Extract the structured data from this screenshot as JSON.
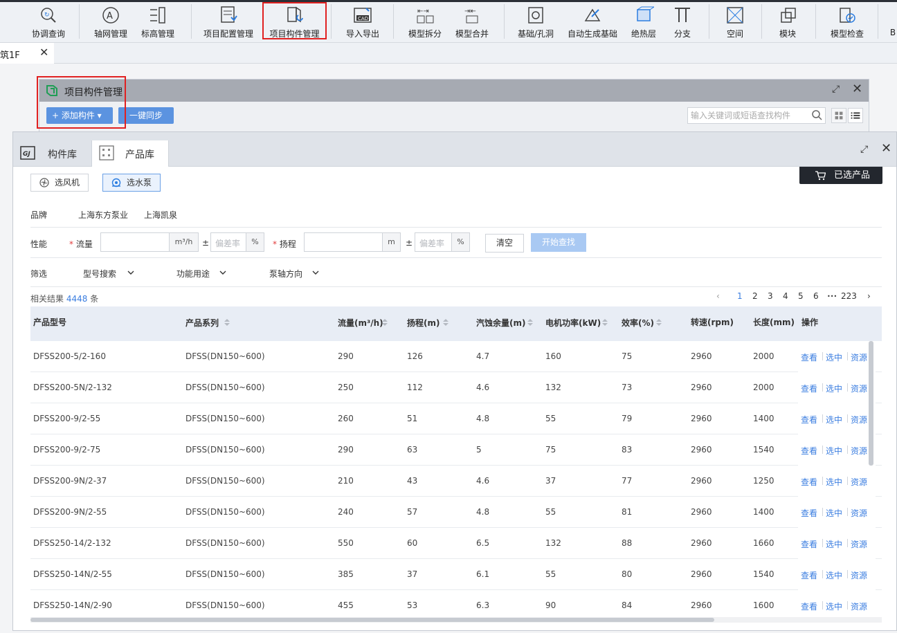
{
  "ribbon": {
    "items": [
      {
        "label": "协调查询",
        "icon": "coordination-query-icon"
      },
      {
        "label": "轴网管理",
        "icon": "axis-grid-icon"
      },
      {
        "label": "标高管理",
        "icon": "elevation-icon"
      },
      {
        "label": "项目配置管理",
        "icon": "project-config-icon"
      },
      {
        "label": "项目构件管理",
        "icon": "project-component-icon"
      },
      {
        "label": "导入导出",
        "icon": "cad-import-export-icon"
      },
      {
        "label": "模型拆分",
        "icon": "model-split-icon"
      },
      {
        "label": "模型合并",
        "icon": "model-merge-icon"
      },
      {
        "label": "基础/孔洞",
        "icon": "foundation-hole-icon"
      },
      {
        "label": "自动生成基础",
        "icon": "auto-foundation-icon"
      },
      {
        "label": "绝热层",
        "icon": "insulation-icon"
      },
      {
        "label": "分支",
        "icon": "branch-icon"
      },
      {
        "label": "空间",
        "icon": "space-icon"
      },
      {
        "label": "模块",
        "icon": "module-icon"
      },
      {
        "label": "模型检查",
        "icon": "model-check-icon"
      },
      {
        "label": "B",
        "icon": ""
      }
    ]
  },
  "tabbar": {
    "tab_label": "筑1F",
    "close": "✕"
  },
  "panel_back": {
    "title": "项目构件管理",
    "add_button": "+ 添加构件 ▾",
    "sync_button": "一键同步",
    "search_placeholder": "输入关键词或短语查找构件"
  },
  "panel_front": {
    "tabs": [
      {
        "label": "构件库",
        "icon": "gj-library-icon"
      },
      {
        "label": "产品库",
        "icon": "product-library-icon"
      }
    ],
    "select_fan": "选风机",
    "select_pump": "选水泵",
    "selected_products": "已选产品",
    "brand": {
      "label": "品牌",
      "options": [
        "上海东方泵业",
        "上海凯泉"
      ]
    },
    "performance": {
      "label": "性能",
      "flow_label": "流量",
      "flow_unit": "m³/h",
      "head_label": "扬程",
      "head_unit": "m",
      "plus_minus": "±",
      "deviation_placeholder": "偏差率",
      "percent": "%",
      "clear": "清空",
      "search": "开始查找"
    },
    "filter": {
      "label": "筛选",
      "dropdowns": [
        "型号搜索",
        "功能用途",
        "泵轴方向"
      ]
    },
    "result": {
      "prefix": "相关结果 ",
      "count": "4448",
      "suffix": " 条"
    },
    "pager": {
      "prev": "‹",
      "pages": [
        "1",
        "2",
        "3",
        "4",
        "5",
        "6"
      ],
      "ellipsis": "•••",
      "last": "223",
      "next": "›",
      "current": "1"
    },
    "columns": [
      "产品型号",
      "产品系列",
      "流量(m³/h)",
      "扬程(m)",
      "汽蚀余量(m)",
      "电机功率(kW)",
      "效率(%)",
      "转速(rpm)",
      "长度(mm)",
      "操作"
    ],
    "actions": [
      "查看",
      "选中",
      "资源"
    ],
    "rows": [
      [
        "DFSS200-5/2-160",
        "DFSS(DN150~600)",
        "290",
        "126",
        "4.7",
        "160",
        "75",
        "2960",
        "2000"
      ],
      [
        "DFSS200-5N/2-132",
        "DFSS(DN150~600)",
        "250",
        "112",
        "4.6",
        "132",
        "73",
        "2960",
        "2000"
      ],
      [
        "DFSS200-9/2-55",
        "DFSS(DN150~600)",
        "260",
        "51",
        "4.8",
        "55",
        "79",
        "2960",
        "1400"
      ],
      [
        "DFSS200-9/2-75",
        "DFSS(DN150~600)",
        "290",
        "63",
        "5",
        "75",
        "83",
        "2960",
        "1540"
      ],
      [
        "DFSS200-9N/2-37",
        "DFSS(DN150~600)",
        "210",
        "43",
        "4.6",
        "37",
        "77",
        "2960",
        "1250"
      ],
      [
        "DFSS200-9N/2-55",
        "DFSS(DN150~600)",
        "240",
        "57",
        "4.8",
        "55",
        "81",
        "2960",
        "1400"
      ],
      [
        "DFSS250-14/2-132",
        "DFSS(DN150~600)",
        "550",
        "60",
        "6.5",
        "132",
        "88",
        "2960",
        "1660"
      ],
      [
        "DFSS250-14N/2-55",
        "DFSS(DN150~600)",
        "385",
        "37",
        "6.1",
        "55",
        "80",
        "2960",
        "1540"
      ],
      [
        "DFSS250-14N/2-90",
        "DFSS(DN150~600)",
        "455",
        "53",
        "6.3",
        "90",
        "84",
        "2960",
        "1600"
      ]
    ]
  },
  "colors": {
    "accent": "#3a7de0",
    "button": "#5b93e0",
    "highlight": "#e02020",
    "header_bg": "#e8edf5"
  }
}
